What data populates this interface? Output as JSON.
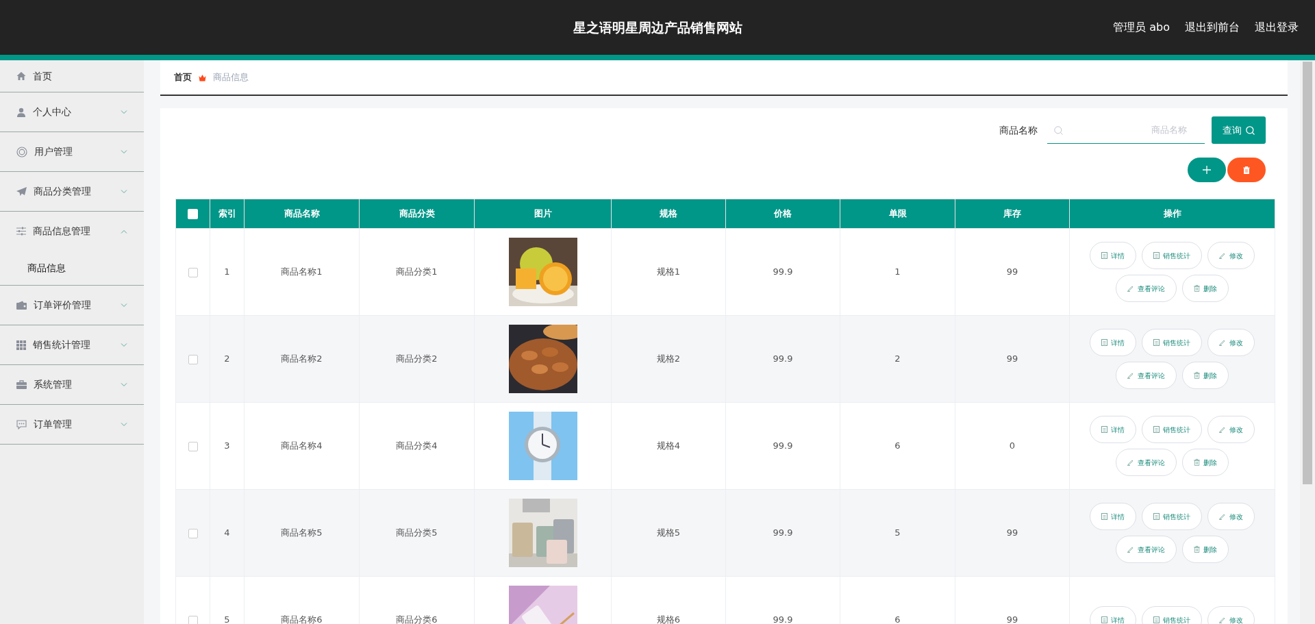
{
  "header": {
    "title": "星之语明星周边产品销售网站",
    "links": [
      "管理员 abo",
      "退出到前台",
      "退出登录"
    ]
  },
  "sidebar": {
    "items": [
      {
        "label": "首页",
        "kind": "link"
      },
      {
        "label": "个人中心",
        "kind": "group",
        "expanded": false
      },
      {
        "label": "用户管理",
        "kind": "group",
        "expanded": false
      },
      {
        "label": "商品分类管理",
        "kind": "group",
        "expanded": false
      },
      {
        "label": "商品信息管理",
        "kind": "group",
        "expanded": true,
        "children": [
          {
            "label": "商品信息"
          }
        ]
      },
      {
        "label": "订单评价管理",
        "kind": "group",
        "expanded": false
      },
      {
        "label": "销售统计管理",
        "kind": "group",
        "expanded": false
      },
      {
        "label": "系统管理",
        "kind": "group",
        "expanded": false
      },
      {
        "label": "订单管理",
        "kind": "group",
        "expanded": false
      }
    ]
  },
  "breadcrumb": [
    {
      "label": "首页",
      "current": false
    },
    {
      "label": "商品信息",
      "current": true
    }
  ],
  "search": {
    "label": "商品名称",
    "placeholder": "商品名称",
    "button": "查询"
  },
  "table": {
    "select_all": {
      "checked": false
    },
    "columns": [
      "索引",
      "商品名称",
      "商品分类",
      "图片",
      "规格",
      "价格",
      "单限",
      "库存",
      "操作"
    ],
    "rows": [
      {
        "checked": false,
        "index": "1",
        "name": "商品名称1",
        "category": "商品分类1",
        "spec": "规格1",
        "price": "99.9",
        "limit": "1",
        "stock": "99",
        "actions": [
          {
            "kind": "detail",
            "label": "详情"
          },
          {
            "kind": "stats",
            "label": "销售统计"
          },
          {
            "kind": "edit",
            "label": "修改"
          },
          {
            "kind": "edit",
            "label": "查看评论"
          },
          {
            "kind": "delete",
            "label": "删除"
          }
        ]
      },
      {
        "checked": false,
        "index": "2",
        "name": "商品名称2",
        "category": "商品分类2",
        "spec": "规格2",
        "price": "99.9",
        "limit": "2",
        "stock": "99",
        "actions": [
          {
            "kind": "detail",
            "label": "详情"
          },
          {
            "kind": "stats",
            "label": "销售统计"
          },
          {
            "kind": "edit",
            "label": "修改"
          },
          {
            "kind": "edit",
            "label": "查看评论"
          },
          {
            "kind": "delete",
            "label": "删除"
          }
        ]
      },
      {
        "checked": false,
        "index": "3",
        "name": "商品名称4",
        "category": "商品分类4",
        "spec": "规格4",
        "price": "99.9",
        "limit": "6",
        "stock": "0",
        "actions": [
          {
            "kind": "detail",
            "label": "详情"
          },
          {
            "kind": "stats",
            "label": "销售统计"
          },
          {
            "kind": "edit",
            "label": "修改"
          },
          {
            "kind": "edit",
            "label": "查看评论"
          },
          {
            "kind": "delete",
            "label": "删除"
          }
        ]
      },
      {
        "checked": false,
        "index": "4",
        "name": "商品名称5",
        "category": "商品分类5",
        "spec": "规格5",
        "price": "99.9",
        "limit": "5",
        "stock": "99",
        "actions": [
          {
            "kind": "detail",
            "label": "详情"
          },
          {
            "kind": "stats",
            "label": "销售统计"
          },
          {
            "kind": "edit",
            "label": "修改"
          },
          {
            "kind": "edit",
            "label": "查看评论"
          },
          {
            "kind": "delete",
            "label": "删除"
          }
        ]
      },
      {
        "checked": false,
        "index": "5",
        "name": "商品名称6",
        "category": "商品分类6",
        "spec": "规格6",
        "price": "99.9",
        "limit": "6",
        "stock": "99",
        "actions": [
          {
            "kind": "detail",
            "label": "详情"
          },
          {
            "kind": "stats",
            "label": "销售统计"
          },
          {
            "kind": "edit",
            "label": "修改"
          }
        ]
      }
    ]
  }
}
